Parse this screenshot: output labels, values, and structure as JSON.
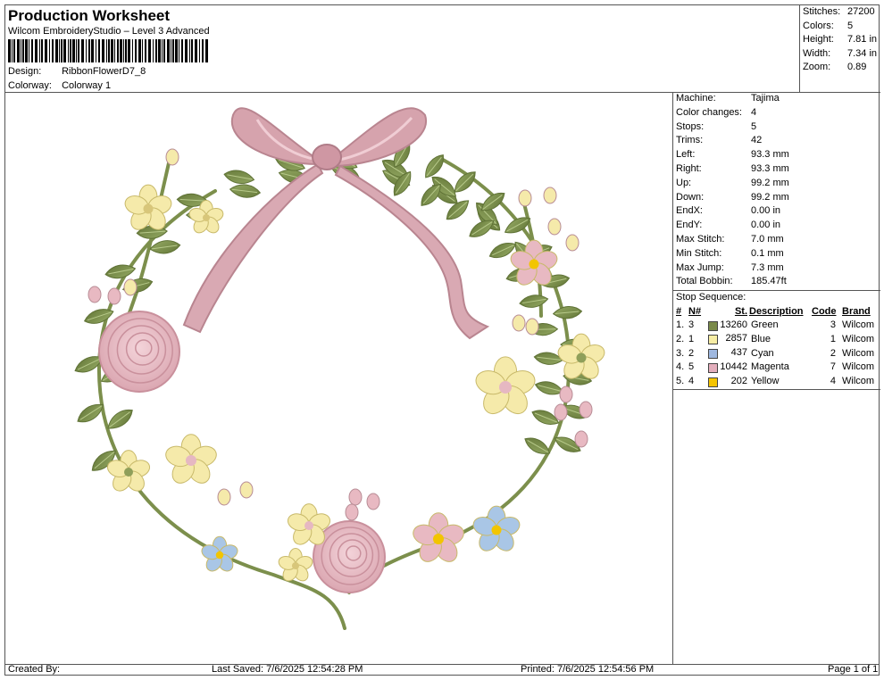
{
  "header": {
    "title": "Production Worksheet",
    "subtitle": "Wilcom EmbroideryStudio – Level 3 Advanced",
    "design_label": "Design:",
    "design_value": "RibbonFlowerD7_8",
    "colorway_label": "Colorway:",
    "colorway_value": "Colorway 1"
  },
  "stats": [
    {
      "k": "Stitches:",
      "v": "27200"
    },
    {
      "k": "Colors:",
      "v": "5"
    },
    {
      "k": "Height:",
      "v": "7.81 in"
    },
    {
      "k": "Width:",
      "v": "7.34 in"
    },
    {
      "k": "Zoom:",
      "v": "0.89"
    }
  ],
  "machine_info": [
    {
      "k": "Machine:",
      "v": "Tajima"
    },
    {
      "k": "Color changes:",
      "v": "4"
    },
    {
      "k": "Stops:",
      "v": "5"
    },
    {
      "k": "Trims:",
      "v": "42"
    },
    {
      "k": "Left:",
      "v": "93.3 mm"
    },
    {
      "k": "Right:",
      "v": "93.3 mm"
    },
    {
      "k": "Up:",
      "v": "99.2 mm"
    },
    {
      "k": "Down:",
      "v": "99.2 mm"
    },
    {
      "k": "EndX:",
      "v": "0.00 in"
    },
    {
      "k": "EndY:",
      "v": "0.00 in"
    },
    {
      "k": "Max Stitch:",
      "v": "7.0 mm"
    },
    {
      "k": "Min Stitch:",
      "v": "0.1 mm"
    },
    {
      "k": "Max Jump:",
      "v": "7.3 mm"
    },
    {
      "k": "Total Bobbin:",
      "v": "185.47ft"
    }
  ],
  "stop_sequence": {
    "label": "Stop Sequence:",
    "columns": [
      "#",
      "N#",
      "St.",
      "Description",
      "Code",
      "Brand"
    ],
    "rows": [
      {
        "idx": "1.",
        "n": "3",
        "color": "#7a8a4a",
        "st": "13260",
        "desc": "Green",
        "code": "3",
        "brand": "Wilcom"
      },
      {
        "idx": "2.",
        "n": "1",
        "color": "#f7eda4",
        "st": "2857",
        "desc": "Blue",
        "code": "1",
        "brand": "Wilcom"
      },
      {
        "idx": "3.",
        "n": "2",
        "color": "#9fb8e0",
        "st": "437",
        "desc": "Cyan",
        "code": "2",
        "brand": "Wilcom"
      },
      {
        "idx": "4.",
        "n": "5",
        "color": "#e3aebc",
        "st": "10442",
        "desc": "Magenta",
        "code": "7",
        "brand": "Wilcom"
      },
      {
        "idx": "5.",
        "n": "4",
        "color": "#f5c400",
        "st": "202",
        "desc": "Yellow",
        "code": "4",
        "brand": "Wilcom"
      }
    ]
  },
  "footer": {
    "created": "Created By:",
    "saved": "Last Saved: 7/6/2025 12:54:28 PM",
    "printed": "Printed: 7/6/2025 12:54:56 PM",
    "page": "Page 1 of 1"
  },
  "colors": {
    "leaf": "#7f9350",
    "leaf_dark": "#5f7236",
    "rose": "#e8b9c2",
    "rose_dark": "#c9909c",
    "bow": "#d6a3ad",
    "cream": "#f5eaaa",
    "blue_flower": "#a9c6e6",
    "center": "#f2c500"
  }
}
